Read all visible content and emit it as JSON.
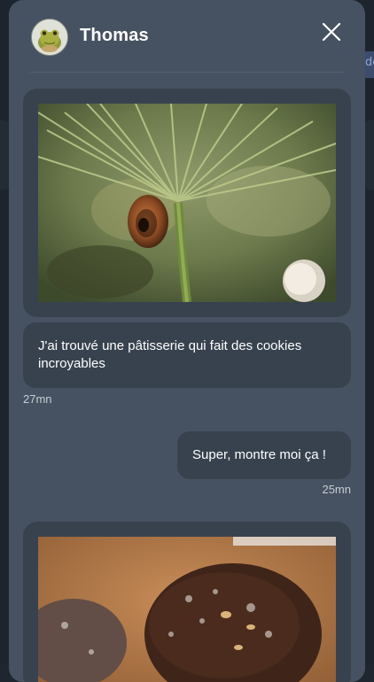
{
  "contact": {
    "name": "Thomas"
  },
  "messages": [
    {
      "text": "J'ai trouvé une pâtisserie qui fait des cookies incroyables",
      "time": "27mn"
    },
    {
      "text": "Super, montre moi ça !",
      "time": "25mn"
    }
  ],
  "background": {
    "peek_label": "de"
  },
  "colors": {
    "modal_bg": "#465261",
    "bubble_bg": "#38424e",
    "text": "#ffffff",
    "timestamp": "#c6ccd4"
  },
  "icons": {
    "close": "close-icon",
    "avatar": "avatar-frog"
  }
}
